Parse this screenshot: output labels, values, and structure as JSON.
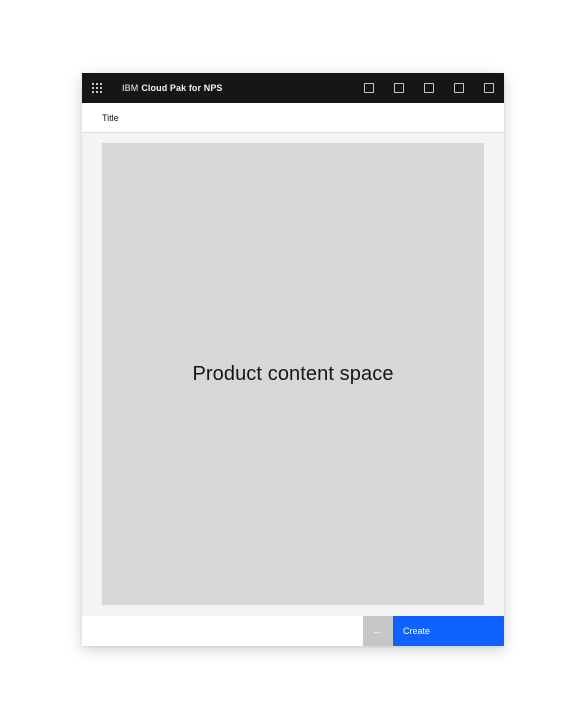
{
  "topbar": {
    "brand_prefix": "IBM",
    "brand_product": "Cloud Pak for NPS",
    "actions": [
      "action-1",
      "action-2",
      "action-3",
      "action-4",
      "action-5"
    ]
  },
  "header": {
    "title": "Title"
  },
  "content": {
    "label": "Product content space"
  },
  "footer": {
    "back_icon": "←",
    "create_label": "Create"
  },
  "colors": {
    "topbar_bg": "#161616",
    "content_bg": "#d8d6d7",
    "primary": "#0f62fe",
    "disabled": "#c6c6c6"
  }
}
